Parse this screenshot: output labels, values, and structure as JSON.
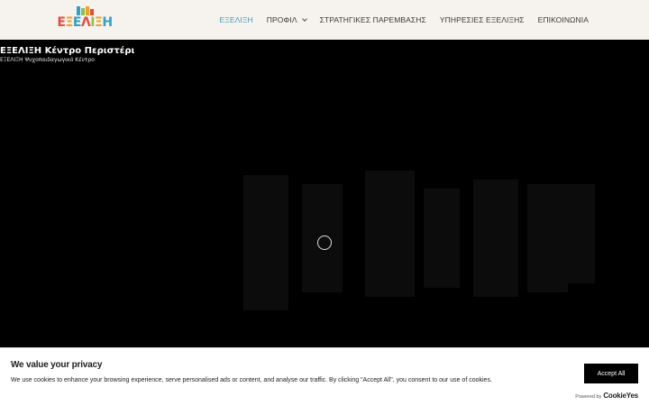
{
  "brand": {
    "logo_letters": [
      "Ε",
      "Ξ",
      "Ε",
      "Λ",
      "Ι",
      "Ξ",
      "Η"
    ],
    "logo_colors": [
      "#e94b3c",
      "#f4a020",
      "#2ea3c8",
      "#e94b3c",
      "#8bc34a",
      "#f4a020",
      "#2ea3c8"
    ],
    "book_colors": [
      "#2ea3c8",
      "#8bc34a",
      "#f4a020",
      "#e94b3c"
    ]
  },
  "nav": {
    "items": [
      {
        "label": "ΕΞΕΛΙΞΗ",
        "active": true,
        "dropdown": false
      },
      {
        "label": "ΠΡΟΦΙΛ",
        "active": false,
        "dropdown": true
      },
      {
        "label": "ΣΤΡΑΤΗΓΙΚΕΣ ΠΑΡΕΜΒΑΣΗΣ",
        "active": false,
        "dropdown": false
      },
      {
        "label": "ΥΠΗΡΕΣΙΕΣ ΕΞΕΛΙΞΗΣ",
        "active": false,
        "dropdown": false
      },
      {
        "label": "ΕΠΙΚΟΙΝΩΝΙΑ",
        "active": false,
        "dropdown": false
      }
    ],
    "active_color": "#3aa0c8"
  },
  "hero": {
    "title": "ΕΞΕΛΙΞΗ Κέντρο Περιστέρι",
    "subtitle": "ΕΞΕΛΙΞΗ Ψυχοπαιδαγωγικό Κέντρο",
    "loading": true
  },
  "cookie_banner": {
    "title": "We value your privacy",
    "text": "We use cookies to enhance your browsing experience, serve personalised ads or content, and analyse our traffic. By clicking \"Accept All\", you consent to our use of cookies.",
    "accept_label": "Accept All",
    "powered_by_label": "Powered by",
    "powered_by_brand": "CookieYes"
  }
}
